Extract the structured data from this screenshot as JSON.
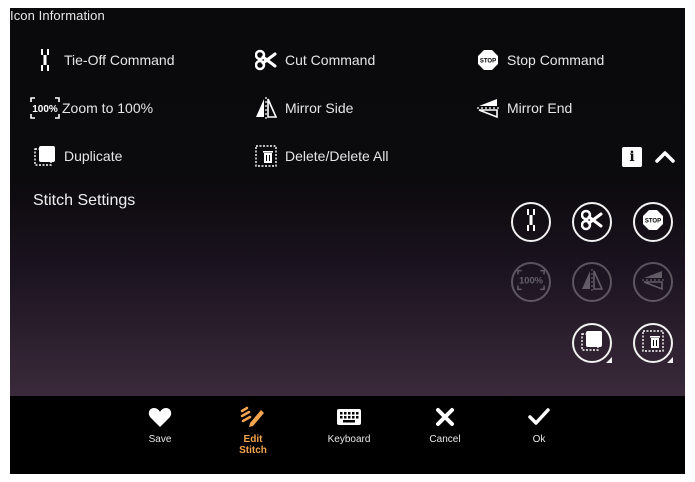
{
  "panel": {
    "title": "Icon Information",
    "legend": [
      {
        "icon": "tie-off-icon",
        "label": "Tie-Off Command"
      },
      {
        "icon": "scissors-icon",
        "label": "Cut Command"
      },
      {
        "icon": "stop-icon",
        "label": "Stop Command",
        "icon_text": "STOP"
      },
      {
        "icon": "zoom-100-icon",
        "label": "Zoom to 100%",
        "icon_text": "100%"
      },
      {
        "icon": "mirror-side-icon",
        "label": "Mirror Side"
      },
      {
        "icon": "mirror-end-icon",
        "label": "Mirror End"
      },
      {
        "icon": "duplicate-icon",
        "label": "Duplicate"
      },
      {
        "icon": "delete-icon",
        "label": "Delete/Delete All"
      }
    ],
    "info_button": "i"
  },
  "section": {
    "heading": "Stitch Settings",
    "buttons": [
      {
        "icon": "tie-off-icon",
        "enabled": true
      },
      {
        "icon": "scissors-icon",
        "enabled": true
      },
      {
        "icon": "stop-icon",
        "enabled": true,
        "icon_text": "STOP"
      },
      {
        "icon": "zoom-100-icon",
        "enabled": false,
        "icon_text": "100%"
      },
      {
        "icon": "mirror-side-icon",
        "enabled": false
      },
      {
        "icon": "mirror-end-icon",
        "enabled": false
      },
      {
        "icon": "duplicate-icon",
        "enabled": true
      },
      {
        "icon": "delete-icon",
        "enabled": true
      }
    ]
  },
  "toolbar": {
    "save": "Save",
    "edit_stitch_line1": "Edit",
    "edit_stitch_line2": "Stitch",
    "keyboard": "Keyboard",
    "cancel": "Cancel",
    "ok": "Ok"
  },
  "colors": {
    "active": "#f3a44e",
    "background_top": "#0a090b",
    "background_bottom": "#3a2a3b",
    "toolbar": "#000000"
  }
}
